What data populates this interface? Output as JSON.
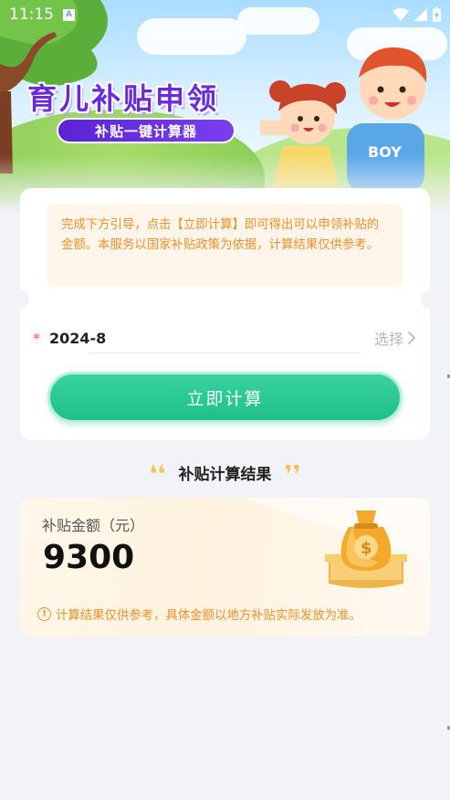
{
  "status_bar": {
    "time": "11:15",
    "notification_badge": "A",
    "icons": [
      "wifi-icon",
      "signal-icon",
      "battery-charging-icon"
    ]
  },
  "banner": {
    "title": "育儿补贴申领",
    "subtitle": "补贴一键计算器",
    "shirt_text": "BOY"
  },
  "calculator": {
    "notice": "完成下方引导，点击【立即计算】即可得出可以申领补贴的金额。本服务以国家补贴政策为依据，计算结果仅供参考。",
    "date_field": {
      "required_mark": "*",
      "value": "2024-8",
      "select_label": "选择"
    },
    "calculate_button": "立即计算"
  },
  "result": {
    "heading": "补贴计算结果",
    "amount_label": "补贴金额（元）",
    "amount": "9300",
    "disclaimer": "计算结果仅供参考，具体金额以地方补贴实际发放为准。",
    "icon": "money-bag-icon"
  },
  "colors": {
    "primary_green": "#1fbf88",
    "notice_orange": "#f0902a",
    "banner_purple": "#6a2bd8",
    "required_red": "#ff4d4f",
    "page_bg": "#f2f3f7"
  }
}
